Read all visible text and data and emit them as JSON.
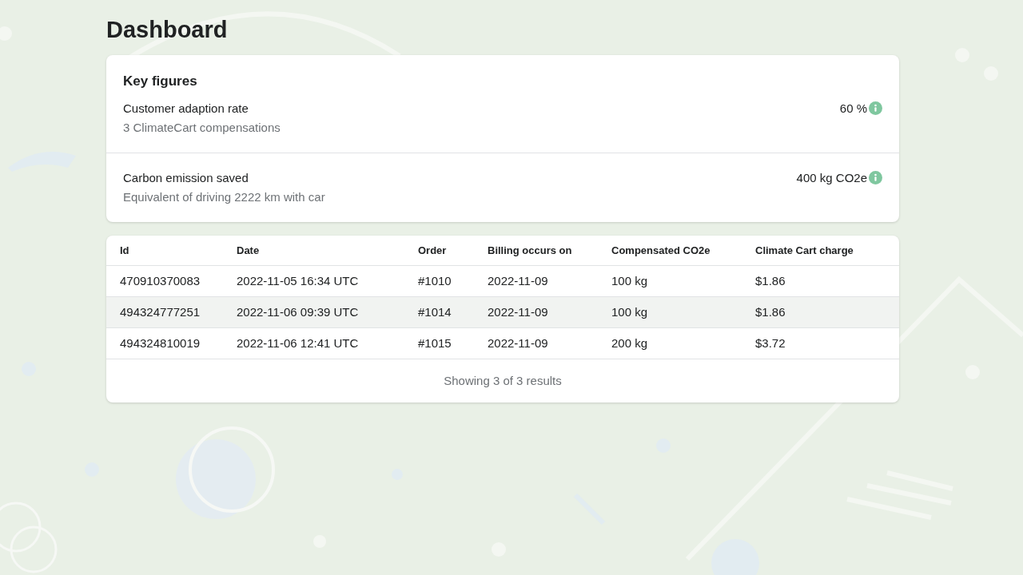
{
  "page_title": "Dashboard",
  "key_figures": {
    "title": "Key figures",
    "items": [
      {
        "label": "Customer adaption rate",
        "detail": "3 ClimateCart compensations",
        "value": "60 %"
      },
      {
        "label": "Carbon emission saved",
        "detail": "Equivalent of driving 2222 km with car",
        "value": "400 kg CO2e"
      }
    ]
  },
  "table": {
    "columns": [
      "Id",
      "Date",
      "Order",
      "Billing occurs on",
      "Compensated CO2e",
      "Climate Cart charge"
    ],
    "rows": [
      {
        "cells": [
          "470910370083",
          "2022-11-05 16:34 UTC",
          "#1010",
          "2022-11-09",
          "100 kg",
          "$1.86"
        ],
        "hovered": false
      },
      {
        "cells": [
          "494324777251",
          "2022-11-06 09:39 UTC",
          "#1014",
          "2022-11-09",
          "100 kg",
          "$1.86"
        ],
        "hovered": true
      },
      {
        "cells": [
          "494324810019",
          "2022-11-06 12:41 UTC",
          "#1015",
          "2022-11-09",
          "200 kg",
          "$3.72"
        ],
        "hovered": false
      }
    ],
    "footer": "Showing 3 of 3 results"
  }
}
